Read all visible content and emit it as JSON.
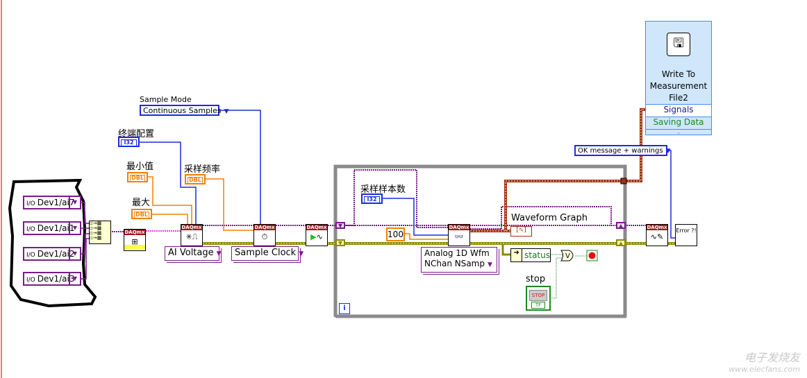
{
  "channels": [
    "Dev1/ai7",
    "Dev1/ai1",
    "Dev1/ai2",
    "Dev1/ai3"
  ],
  "sample_mode": {
    "label": "Sample Mode",
    "value": "Continuous Samples"
  },
  "terminal_config": {
    "label": "终端配置",
    "type": "I32"
  },
  "min_value": {
    "label": "最小值",
    "type": "DBL"
  },
  "max_value": {
    "label": "最大",
    "type": "DBL"
  },
  "sample_rate": {
    "label": "采样频率",
    "type": "DBL"
  },
  "samples_per_channel": {
    "label": "采样样本数",
    "type": "I32"
  },
  "daqmx_header": "DAQmx",
  "create_channel_selector": "AI Voltage",
  "timing_selector": "Sample Clock",
  "read_selector_line1": "Analog 1D Wfm",
  "read_selector_line2": "NChan NSamp",
  "timeout_constant": "100",
  "waveform_graph": {
    "label": "Waveform Graph"
  },
  "status_label": "status",
  "stop": {
    "label": "stop",
    "button_text": "STOP",
    "type": "TF"
  },
  "loop_iteration": "i",
  "write_file": {
    "title_line1": "Write To",
    "title_line2": "Measurement",
    "title_line3": "File2",
    "signals": "Signals",
    "saving_data": "Saving Data"
  },
  "error_handler": {
    "enum_value": "OK message + warnings",
    "icon_text": "Error ?!"
  },
  "watermark": {
    "line1": "电子发烧友",
    "line2": "www.elecfans.com"
  },
  "colors": {
    "task_wire": "#7a1a8a",
    "error_wire": "#8a8a00",
    "dbl": "#f08000",
    "i32": "#1a2be0",
    "waveform": "#a03010",
    "loop": "#8a8a8a"
  }
}
